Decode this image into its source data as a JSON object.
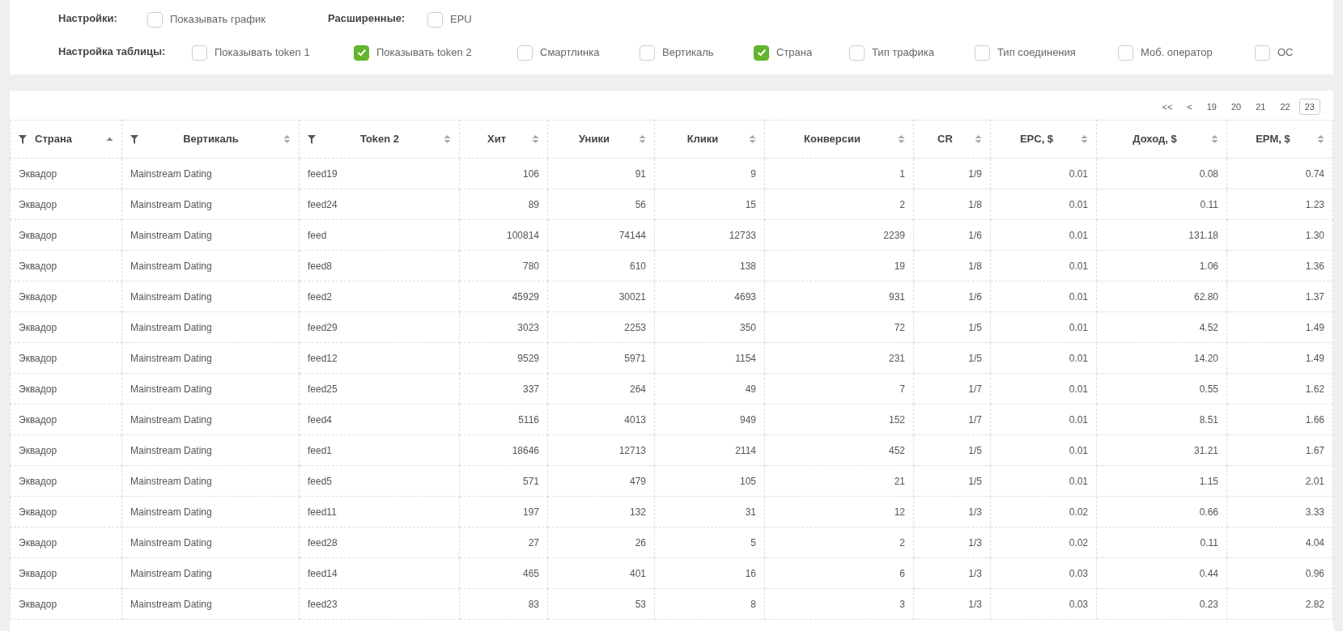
{
  "settings": [
    {
      "label": "Настройки:",
      "options": [
        {
          "label": "Показывать график",
          "checked": false
        }
      ]
    },
    {
      "label": "Расширенные:",
      "options": [
        {
          "label": "EPU",
          "checked": false
        }
      ]
    }
  ],
  "table_settings": {
    "label": "Настройка таблицы:",
    "options": [
      {
        "label": "Показывать token 1",
        "checked": false
      },
      {
        "label": "Показывать token 2",
        "checked": true
      },
      {
        "label": "Смартлинка",
        "checked": false
      },
      {
        "label": "Вертикаль",
        "checked": false
      },
      {
        "label": "Страна",
        "checked": true
      },
      {
        "label": "Тип трафика",
        "checked": false
      },
      {
        "label": "Тип соединения",
        "checked": false
      },
      {
        "label": "Моб. оператор",
        "checked": false
      },
      {
        "label": "ОС",
        "checked": false
      }
    ]
  },
  "pagination": [
    {
      "label": "<<",
      "selected": false
    },
    {
      "label": "<",
      "selected": false
    },
    {
      "label": "19",
      "selected": false
    },
    {
      "label": "20",
      "selected": false
    },
    {
      "label": "21",
      "selected": false
    },
    {
      "label": "22",
      "selected": false
    },
    {
      "label": "23",
      "selected": true
    }
  ],
  "table": {
    "columns": [
      {
        "label": "Страна",
        "filter": true,
        "sorted": true,
        "kind": "text"
      },
      {
        "label": "Вертикаль",
        "filter": true,
        "sorted": false,
        "kind": "text"
      },
      {
        "label": "Token 2",
        "filter": true,
        "sorted": false,
        "kind": "text"
      },
      {
        "label": "Хит",
        "filter": false,
        "sorted": false,
        "kind": "number"
      },
      {
        "label": "Уники",
        "filter": false,
        "sorted": false,
        "kind": "number"
      },
      {
        "label": "Клики",
        "filter": false,
        "sorted": false,
        "kind": "number"
      },
      {
        "label": "Конверсии",
        "filter": false,
        "sorted": false,
        "kind": "number"
      },
      {
        "label": "CR",
        "filter": false,
        "sorted": false,
        "kind": "number"
      },
      {
        "label": "EPC, $",
        "filter": false,
        "sorted": false,
        "kind": "number"
      },
      {
        "label": "Доход, $",
        "filter": false,
        "sorted": false,
        "kind": "number"
      },
      {
        "label": "EPM, $",
        "filter": false,
        "sorted": false,
        "kind": "number"
      }
    ],
    "rows": [
      [
        "Эквадор",
        "Mainstream Dating",
        "feed19",
        "106",
        "91",
        "9",
        "1",
        "1/9",
        "0.01",
        "0.08",
        "0.74"
      ],
      [
        "Эквадор",
        "Mainstream Dating",
        "feed24",
        "89",
        "56",
        "15",
        "2",
        "1/8",
        "0.01",
        "0.11",
        "1.23"
      ],
      [
        "Эквадор",
        "Mainstream Dating",
        "feed",
        "100814",
        "74144",
        "12733",
        "2239",
        "1/6",
        "0.01",
        "131.18",
        "1.30"
      ],
      [
        "Эквадор",
        "Mainstream Dating",
        "feed8",
        "780",
        "610",
        "138",
        "19",
        "1/8",
        "0.01",
        "1.06",
        "1.36"
      ],
      [
        "Эквадор",
        "Mainstream Dating",
        "feed2",
        "45929",
        "30021",
        "4693",
        "931",
        "1/6",
        "0.01",
        "62.80",
        "1.37"
      ],
      [
        "Эквадор",
        "Mainstream Dating",
        "feed29",
        "3023",
        "2253",
        "350",
        "72",
        "1/5",
        "0.01",
        "4.52",
        "1.49"
      ],
      [
        "Эквадор",
        "Mainstream Dating",
        "feed12",
        "9529",
        "5971",
        "1154",
        "231",
        "1/5",
        "0.01",
        "14.20",
        "1.49"
      ],
      [
        "Эквадор",
        "Mainstream Dating",
        "feed25",
        "337",
        "264",
        "49",
        "7",
        "1/7",
        "0.01",
        "0.55",
        "1.62"
      ],
      [
        "Эквадор",
        "Mainstream Dating",
        "feed4",
        "5116",
        "4013",
        "949",
        "152",
        "1/7",
        "0.01",
        "8.51",
        "1.66"
      ],
      [
        "Эквадор",
        "Mainstream Dating",
        "feed1",
        "18646",
        "12713",
        "2114",
        "452",
        "1/5",
        "0.01",
        "31.21",
        "1.67"
      ],
      [
        "Эквадор",
        "Mainstream Dating",
        "feed5",
        "571",
        "479",
        "105",
        "21",
        "1/5",
        "0.01",
        "1.15",
        "2.01"
      ],
      [
        "Эквадор",
        "Mainstream Dating",
        "feed11",
        "197",
        "132",
        "31",
        "12",
        "1/3",
        "0.02",
        "0.66",
        "3.33"
      ],
      [
        "Эквадор",
        "Mainstream Dating",
        "feed28",
        "27",
        "26",
        "5",
        "2",
        "1/3",
        "0.02",
        "0.11",
        "4.04"
      ],
      [
        "Эквадор",
        "Mainstream Dating",
        "feed14",
        "465",
        "401",
        "16",
        "6",
        "1/3",
        "0.03",
        "0.44",
        "0.96"
      ],
      [
        "Эквадор",
        "Mainstream Dating",
        "feed23",
        "83",
        "53",
        "8",
        "3",
        "1/3",
        "0.03",
        "0.23",
        "2.82"
      ]
    ]
  }
}
